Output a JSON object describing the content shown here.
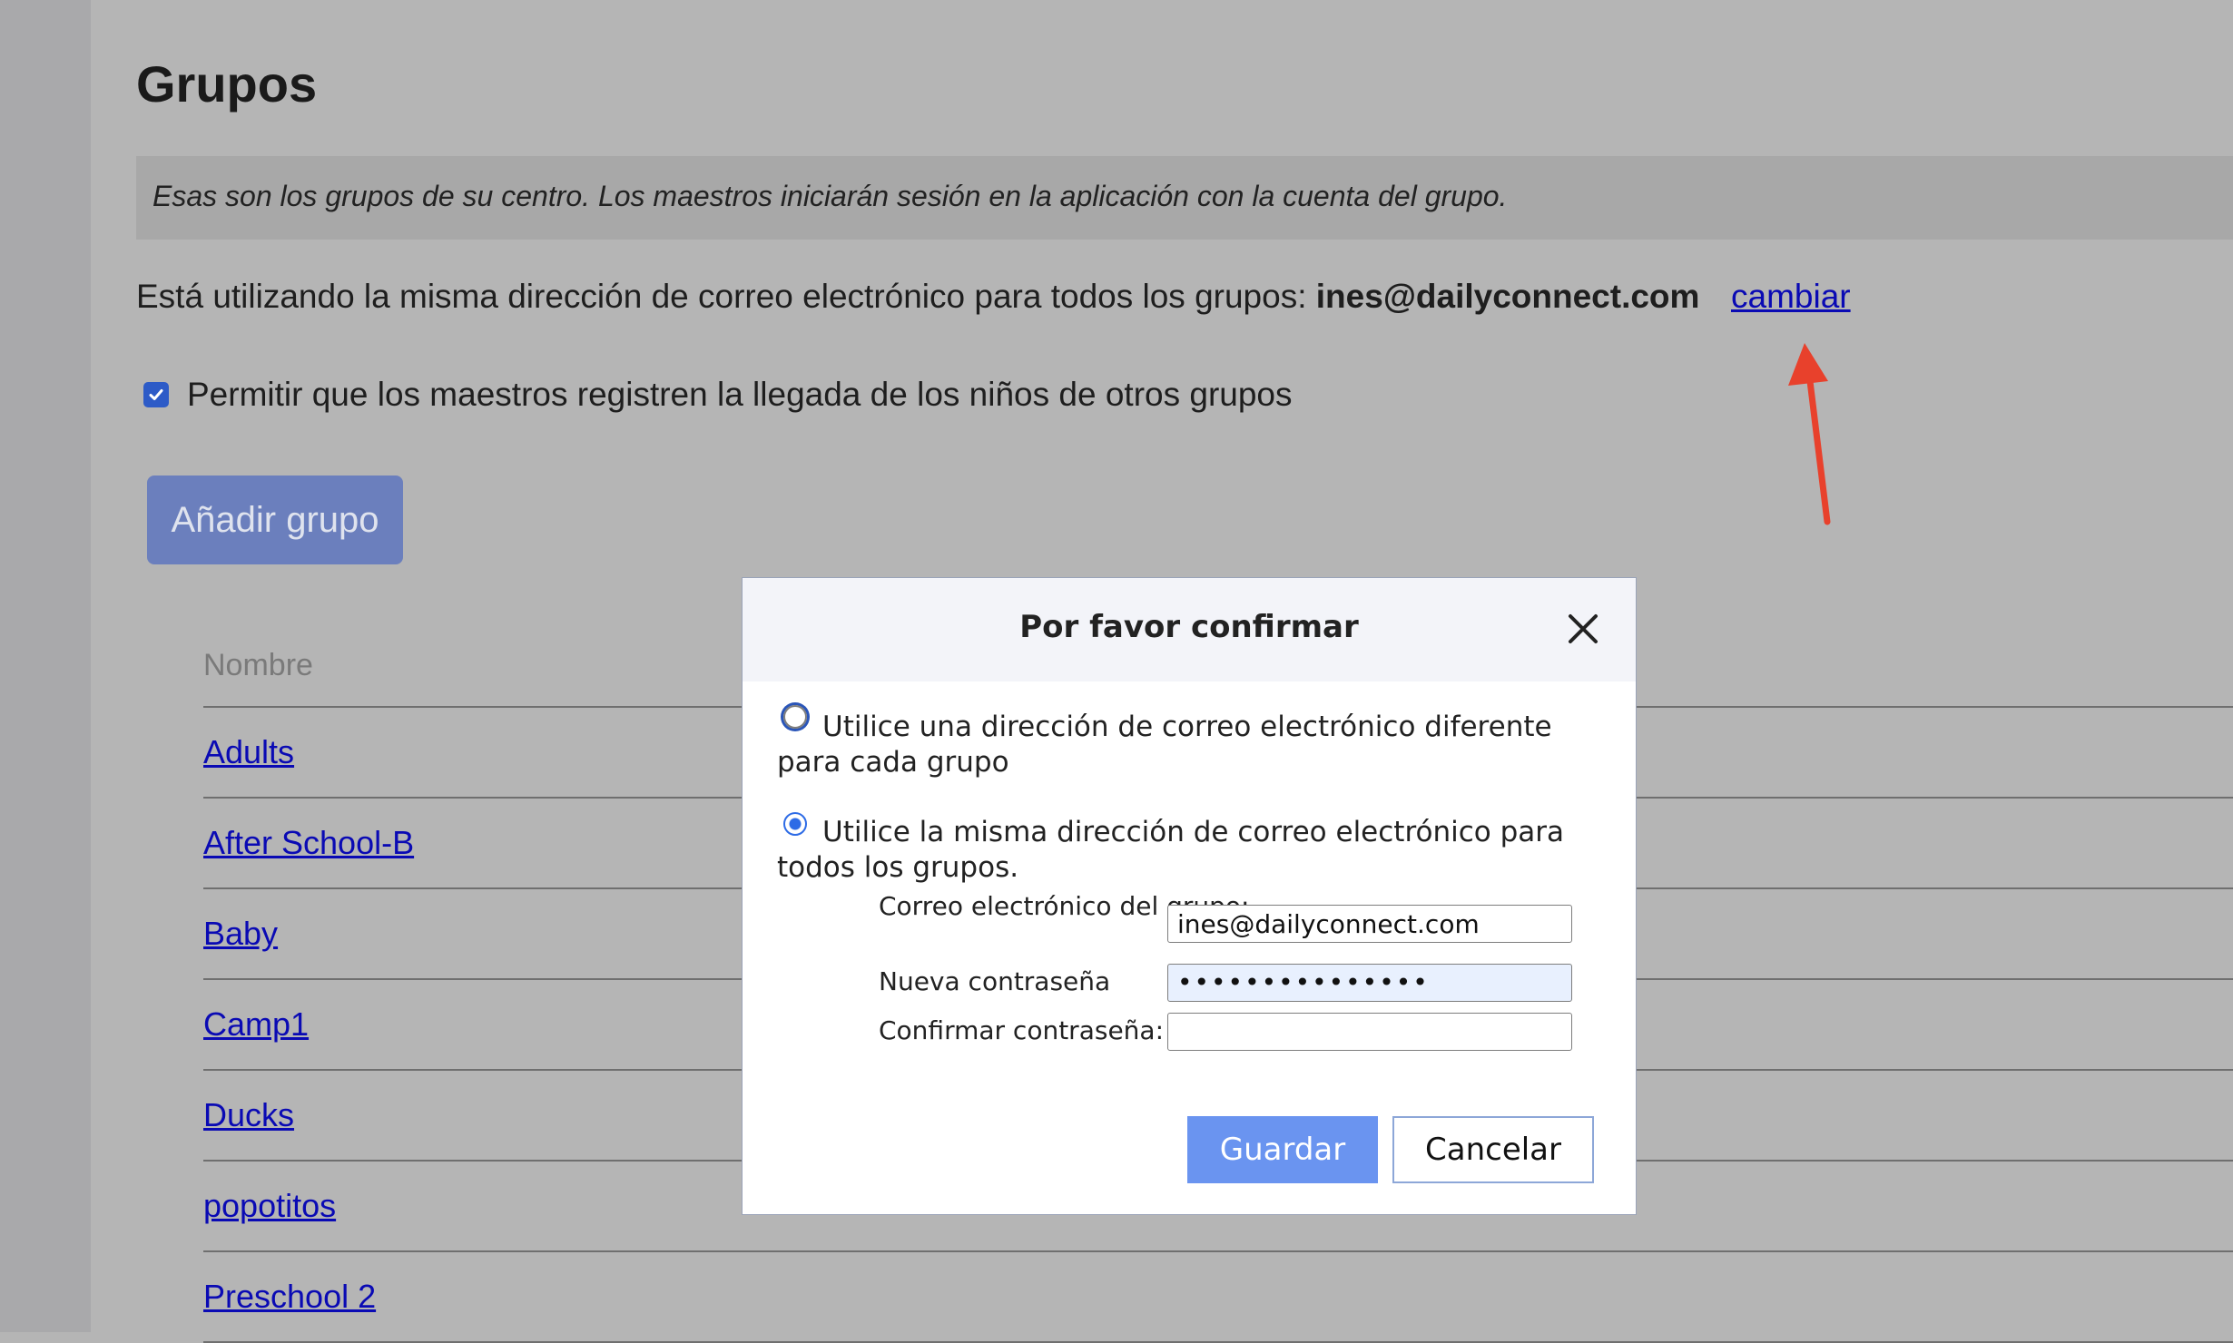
{
  "page": {
    "title": "Grupos",
    "note": "Esas son los grupos de su centro. Los maestros iniciarán sesión en la aplicación con la cuenta del grupo.",
    "email_prefix": "Está utilizando la misma dirección de correo electrónico para todos los grupos:",
    "email": "ines@dailyconnect.com",
    "change_link": "cambiar",
    "permission_label": "Permitir que los maestros registren la llegada de los niños de otros grupos",
    "add_group_button": "Añadir grupo"
  },
  "table": {
    "header": "Nombre",
    "rows": [
      "Adults",
      "After School-B",
      "Baby",
      "Camp1",
      "Ducks",
      "popotitos",
      "Preschool 2"
    ]
  },
  "modal": {
    "title": "Por favor confirmar",
    "option_different": "Utilice una dirección de correo electrónico diferente para cada grupo",
    "option_same": "Utilice la misma dirección de correo electrónico para todos los grupos.",
    "email_label": "Correo electrónico del grupo:",
    "email_value": "ines@dailyconnect.com",
    "new_password_label": "Nueva contraseña",
    "new_password_value": "•••••••••••••••",
    "confirm_password_label": "Confirmar contraseña:",
    "confirm_password_value": "",
    "save_button": "Guardar",
    "cancel_button": "Cancelar"
  },
  "colors": {
    "overlay_bg": "#b5b5b5",
    "link": "#0a0ab4",
    "accent": "#6a94f0",
    "annotation_arrow": "#e8412c"
  }
}
